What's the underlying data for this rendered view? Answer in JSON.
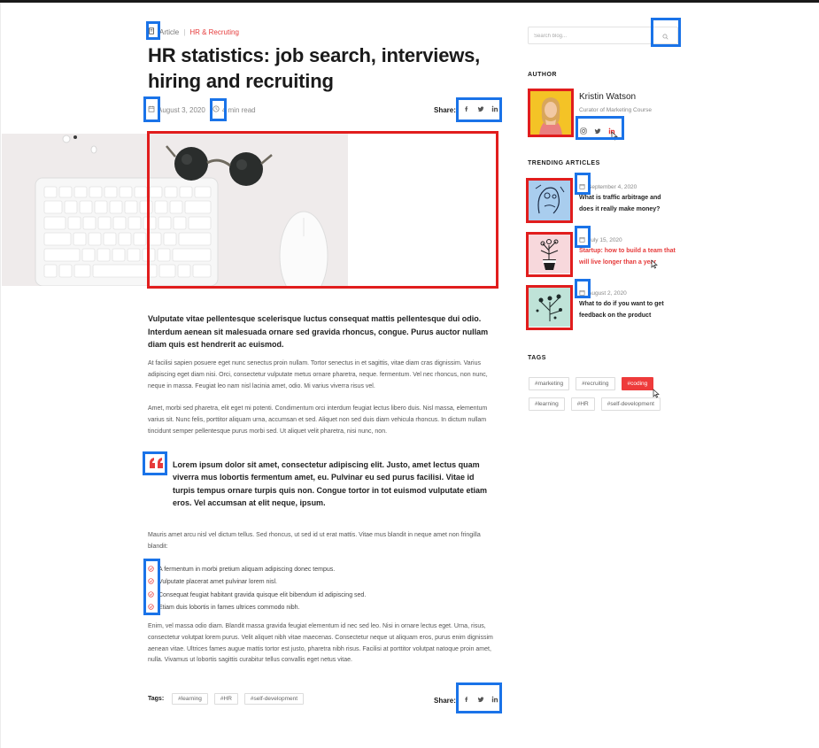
{
  "breadcrumb": {
    "type": "Article",
    "separator": "|",
    "category": "HR & Recruting"
  },
  "article": {
    "title": "HR statistics: job search,  interviews, hiring and recruiting",
    "date": "August 3, 2020",
    "read_time": "4 min read",
    "share_label": "Share:",
    "lead": "Vulputate vitae pellentesque scelerisque luctus consequat mattis pellentesque dui odio. Interdum aenean sit malesuada ornare sed gravida rhoncus, congue. Purus auctor nullam diam quis est hendrerit ac euismod.",
    "para1": "At facilisi sapien posuere eget nunc senectus proin nullam. Tortor senectus in et sagittis, vitae diam cras dignissim. Varius adipiscing eget diam nisi. Orci, consectetur vulputate metus ornare pharetra, neque. fermentum. Vel nec rhoncus, non nunc, neque in massa. Feugiat leo nam nisl lacinia amet, odio. Mi varius viverra risus vel.",
    "para2": "Amet, morbi sed pharetra, elit eget mi potenti. Condimentum orci interdum feugiat lectus libero duis. Nisl massa, elementum varius sit. Nunc felis, porttitor aliquam urna, accumsan et sed. Aliquet non sed duis diam vehicula rhoncus. In dictum nullam tincidunt semper pellentesque purus morbi sed. Ut aliquet velit pharetra, nisi nunc, non.",
    "quote": "Lorem ipsum dolor sit amet, consectetur adipiscing elit. Justo, amet lectus quam viverra mus lobortis fermentum amet, eu. Pulvinar eu sed purus  facilisi. Vitae id turpis tempus ornare turpis quis non. Congue tortor in tot euismod vulputate etiam eros. Vel accumsan at elit neque, ipsum.",
    "para3": "Mauris amet arcu nisl vel dictum tellus. Sed rhoncus, ut sed id ut erat mattis. Vitae mus blandit in neque amet non fringilla blandit:",
    "checklist": [
      "A fermentum in morbi pretium aliquam adipiscing donec tempus.",
      "Vulputate placerat amet pulvinar lorem nisl.",
      "Consequat feugiat habitant gravida quisque elit bibendum id adipiscing sed.",
      "Etiam duis lobortis in fames ultrices commodo nibh."
    ],
    "para4": "Enim, vel massa odio diam. Blandit massa gravida feugiat elementum id nec sed leo. Nisi in ornare lectus eget. Urna, risus, consectetur volutpat lorem purus. Velit aliquet nibh vitae maecenas. Consectetur neque ut aliquam eros, purus enim dignissim aenean vitae. Ultrices fames augue mattis tortor est justo, pharetra nibh risus. Facilisi at porttitor volutpat natoque proin amet, nulla. Vivamus ut lobortis sagittis curabitur tellus convallis eget netus vitae.",
    "tags_label": "Tags:",
    "tags": [
      "#learning",
      "#HR",
      "#self-development"
    ]
  },
  "sidebar": {
    "search_placeholder": "Search blog...",
    "author_heading": "AUTHOR",
    "author_name": "Kristin Watson",
    "author_role": "Curator of Marketing Course",
    "trending_heading": "TRENDING ARTICLES",
    "trending": [
      {
        "date": "September 4, 2020",
        "title": "What is traffic arbitrage and does it really make money?"
      },
      {
        "date": "July 15, 2020",
        "title": "Startup: how to build a team that will live longer than a year"
      },
      {
        "date": "August 2, 2020",
        "title": "What to do if you want to get feedback on the product"
      }
    ],
    "tags_heading": "TAGS",
    "tags": [
      "#marketing",
      "#recruiting",
      "#coding",
      "#learning",
      "#HR",
      "#self-development"
    ],
    "active_tag": "#coding"
  },
  "colors": {
    "accent": "#e63b3b",
    "annotation_blue": "#1a73e8",
    "annotation_red": "#e11d1d"
  },
  "icons": [
    "article-icon",
    "calendar-icon",
    "clock-icon",
    "facebook-icon",
    "twitter-icon",
    "linkedin-icon",
    "instagram-icon",
    "search-icon",
    "quote-icon",
    "check-circle-icon",
    "cursor-icon"
  ]
}
